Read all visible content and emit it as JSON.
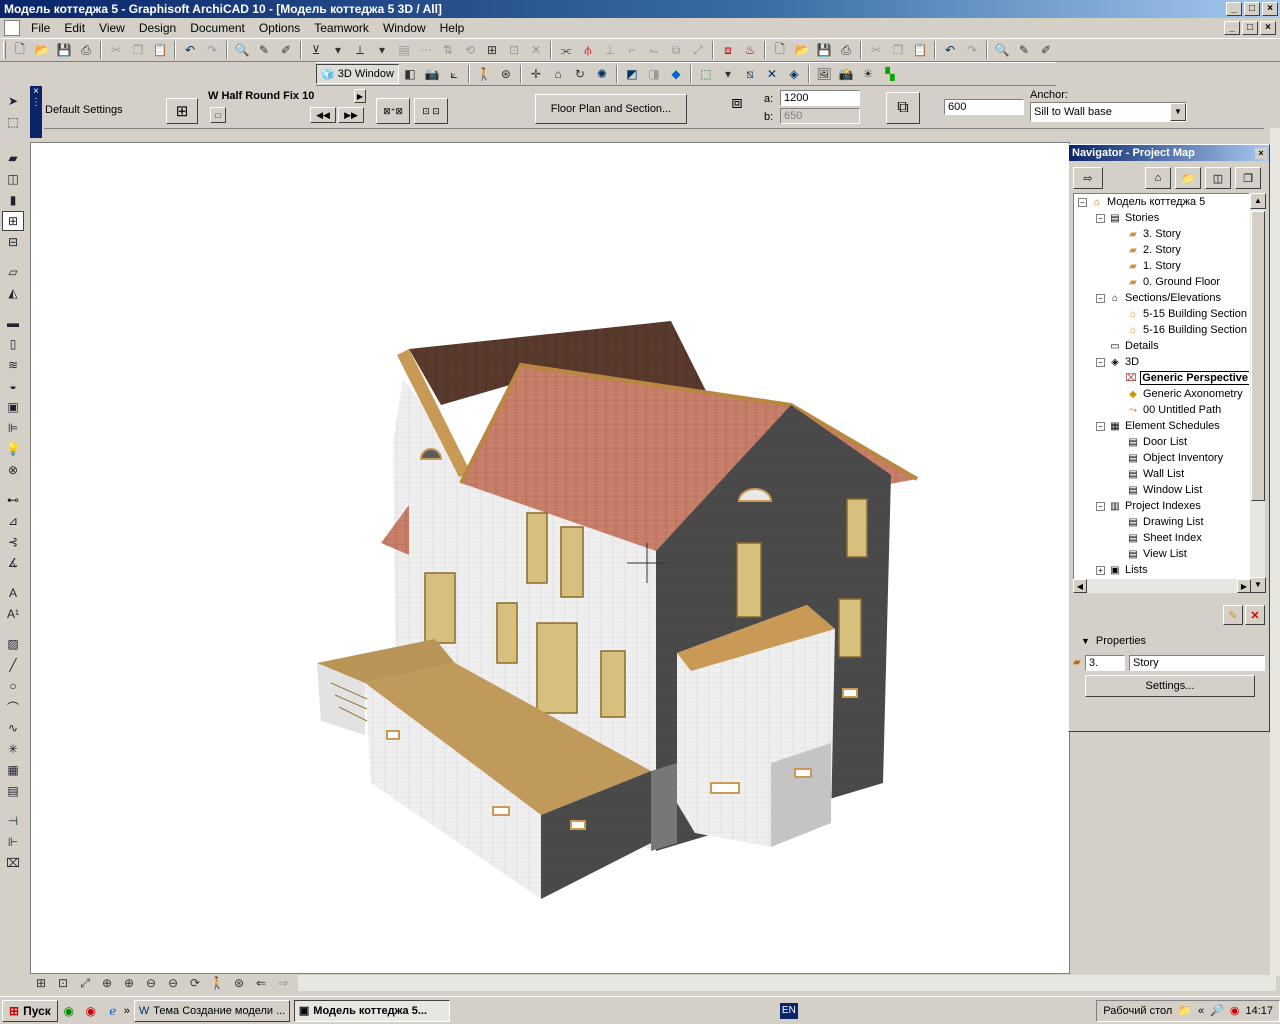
{
  "window": {
    "title": "Модель коттеджа 5 - Graphisoft ArchiCAD 10 - [Модель коттеджа 5 3D / All]",
    "min": "_",
    "max": "□",
    "close": "×"
  },
  "menu": [
    "File",
    "Edit",
    "View",
    "Design",
    "Document",
    "Options",
    "Teamwork",
    "Window",
    "Help"
  ],
  "toolbar2": {
    "view3d_label": "3D Window"
  },
  "infobox": {
    "settings_label": "Default Settings",
    "window_type": "W Half Round Fix 10",
    "floor_plan_button": "Floor Plan and Section...",
    "a_label": "a:",
    "a_value": "1200",
    "b_label": "b:",
    "b_value": "650",
    "height_value": "600",
    "anchor_label": "Anchor:",
    "anchor_value": "Sill to Wall base"
  },
  "navigator": {
    "title": "Navigator - Project Map",
    "tree": [
      {
        "level": 0,
        "exp": "−",
        "icon": "house-icon",
        "label": "Модель коттеджа 5"
      },
      {
        "level": 1,
        "exp": "−",
        "icon": "stories-icon",
        "label": "Stories"
      },
      {
        "level": 2,
        "exp": "",
        "icon": "story-icon",
        "label": "3. Story"
      },
      {
        "level": 2,
        "exp": "",
        "icon": "story-icon",
        "label": "2. Story"
      },
      {
        "level": 2,
        "exp": "",
        "icon": "story-icon",
        "label": "1. Story"
      },
      {
        "level": 2,
        "exp": "",
        "icon": "story-icon",
        "label": "0. Ground Floor"
      },
      {
        "level": 1,
        "exp": "−",
        "icon": "section-icon",
        "label": "Sections/Elevations"
      },
      {
        "level": 2,
        "exp": "",
        "icon": "section-marker-icon",
        "label": "5-15 Building Section"
      },
      {
        "level": 2,
        "exp": "",
        "icon": "section-marker-icon",
        "label": "5-16 Building Section"
      },
      {
        "level": 1,
        "exp": "",
        "icon": "details-icon",
        "label": "Details"
      },
      {
        "level": 1,
        "exp": "−",
        "icon": "cube-icon",
        "label": "3D"
      },
      {
        "level": 2,
        "exp": "",
        "icon": "camera-icon",
        "label": "Generic Perspective",
        "selected": true
      },
      {
        "level": 2,
        "exp": "",
        "icon": "axonometry-icon",
        "label": "Generic Axonometry"
      },
      {
        "level": 2,
        "exp": "",
        "icon": "path-icon",
        "label": "00 Untitled Path"
      },
      {
        "level": 1,
        "exp": "−",
        "icon": "schedule-icon",
        "label": "Element Schedules"
      },
      {
        "level": 2,
        "exp": "",
        "icon": "list-icon",
        "label": "Door List"
      },
      {
        "level": 2,
        "exp": "",
        "icon": "list-icon",
        "label": "Object Inventory"
      },
      {
        "level": 2,
        "exp": "",
        "icon": "list-icon",
        "label": "Wall List"
      },
      {
        "level": 2,
        "exp": "",
        "icon": "list-icon",
        "label": "Window List"
      },
      {
        "level": 1,
        "exp": "−",
        "icon": "index-icon",
        "label": "Project Indexes"
      },
      {
        "level": 2,
        "exp": "",
        "icon": "list-icon",
        "label": "Drawing List"
      },
      {
        "level": 2,
        "exp": "",
        "icon": "list-icon",
        "label": "Sheet Index"
      },
      {
        "level": 2,
        "exp": "",
        "icon": "list-icon",
        "label": "View List"
      },
      {
        "level": 1,
        "exp": "+",
        "icon": "lists-icon",
        "label": "Lists"
      }
    ],
    "properties_label": "Properties",
    "prop_id": "3.",
    "prop_name": "Story",
    "settings_button": "Settings..."
  },
  "taskbar": {
    "start": "Пуск",
    "tasks": [
      {
        "label": "Тема Создание модели ...",
        "active": false
      },
      {
        "label": "Модель коттеджа 5...",
        "active": true
      }
    ],
    "lang": "EN",
    "desktop": "Рабочий стол",
    "time": "14:17"
  }
}
